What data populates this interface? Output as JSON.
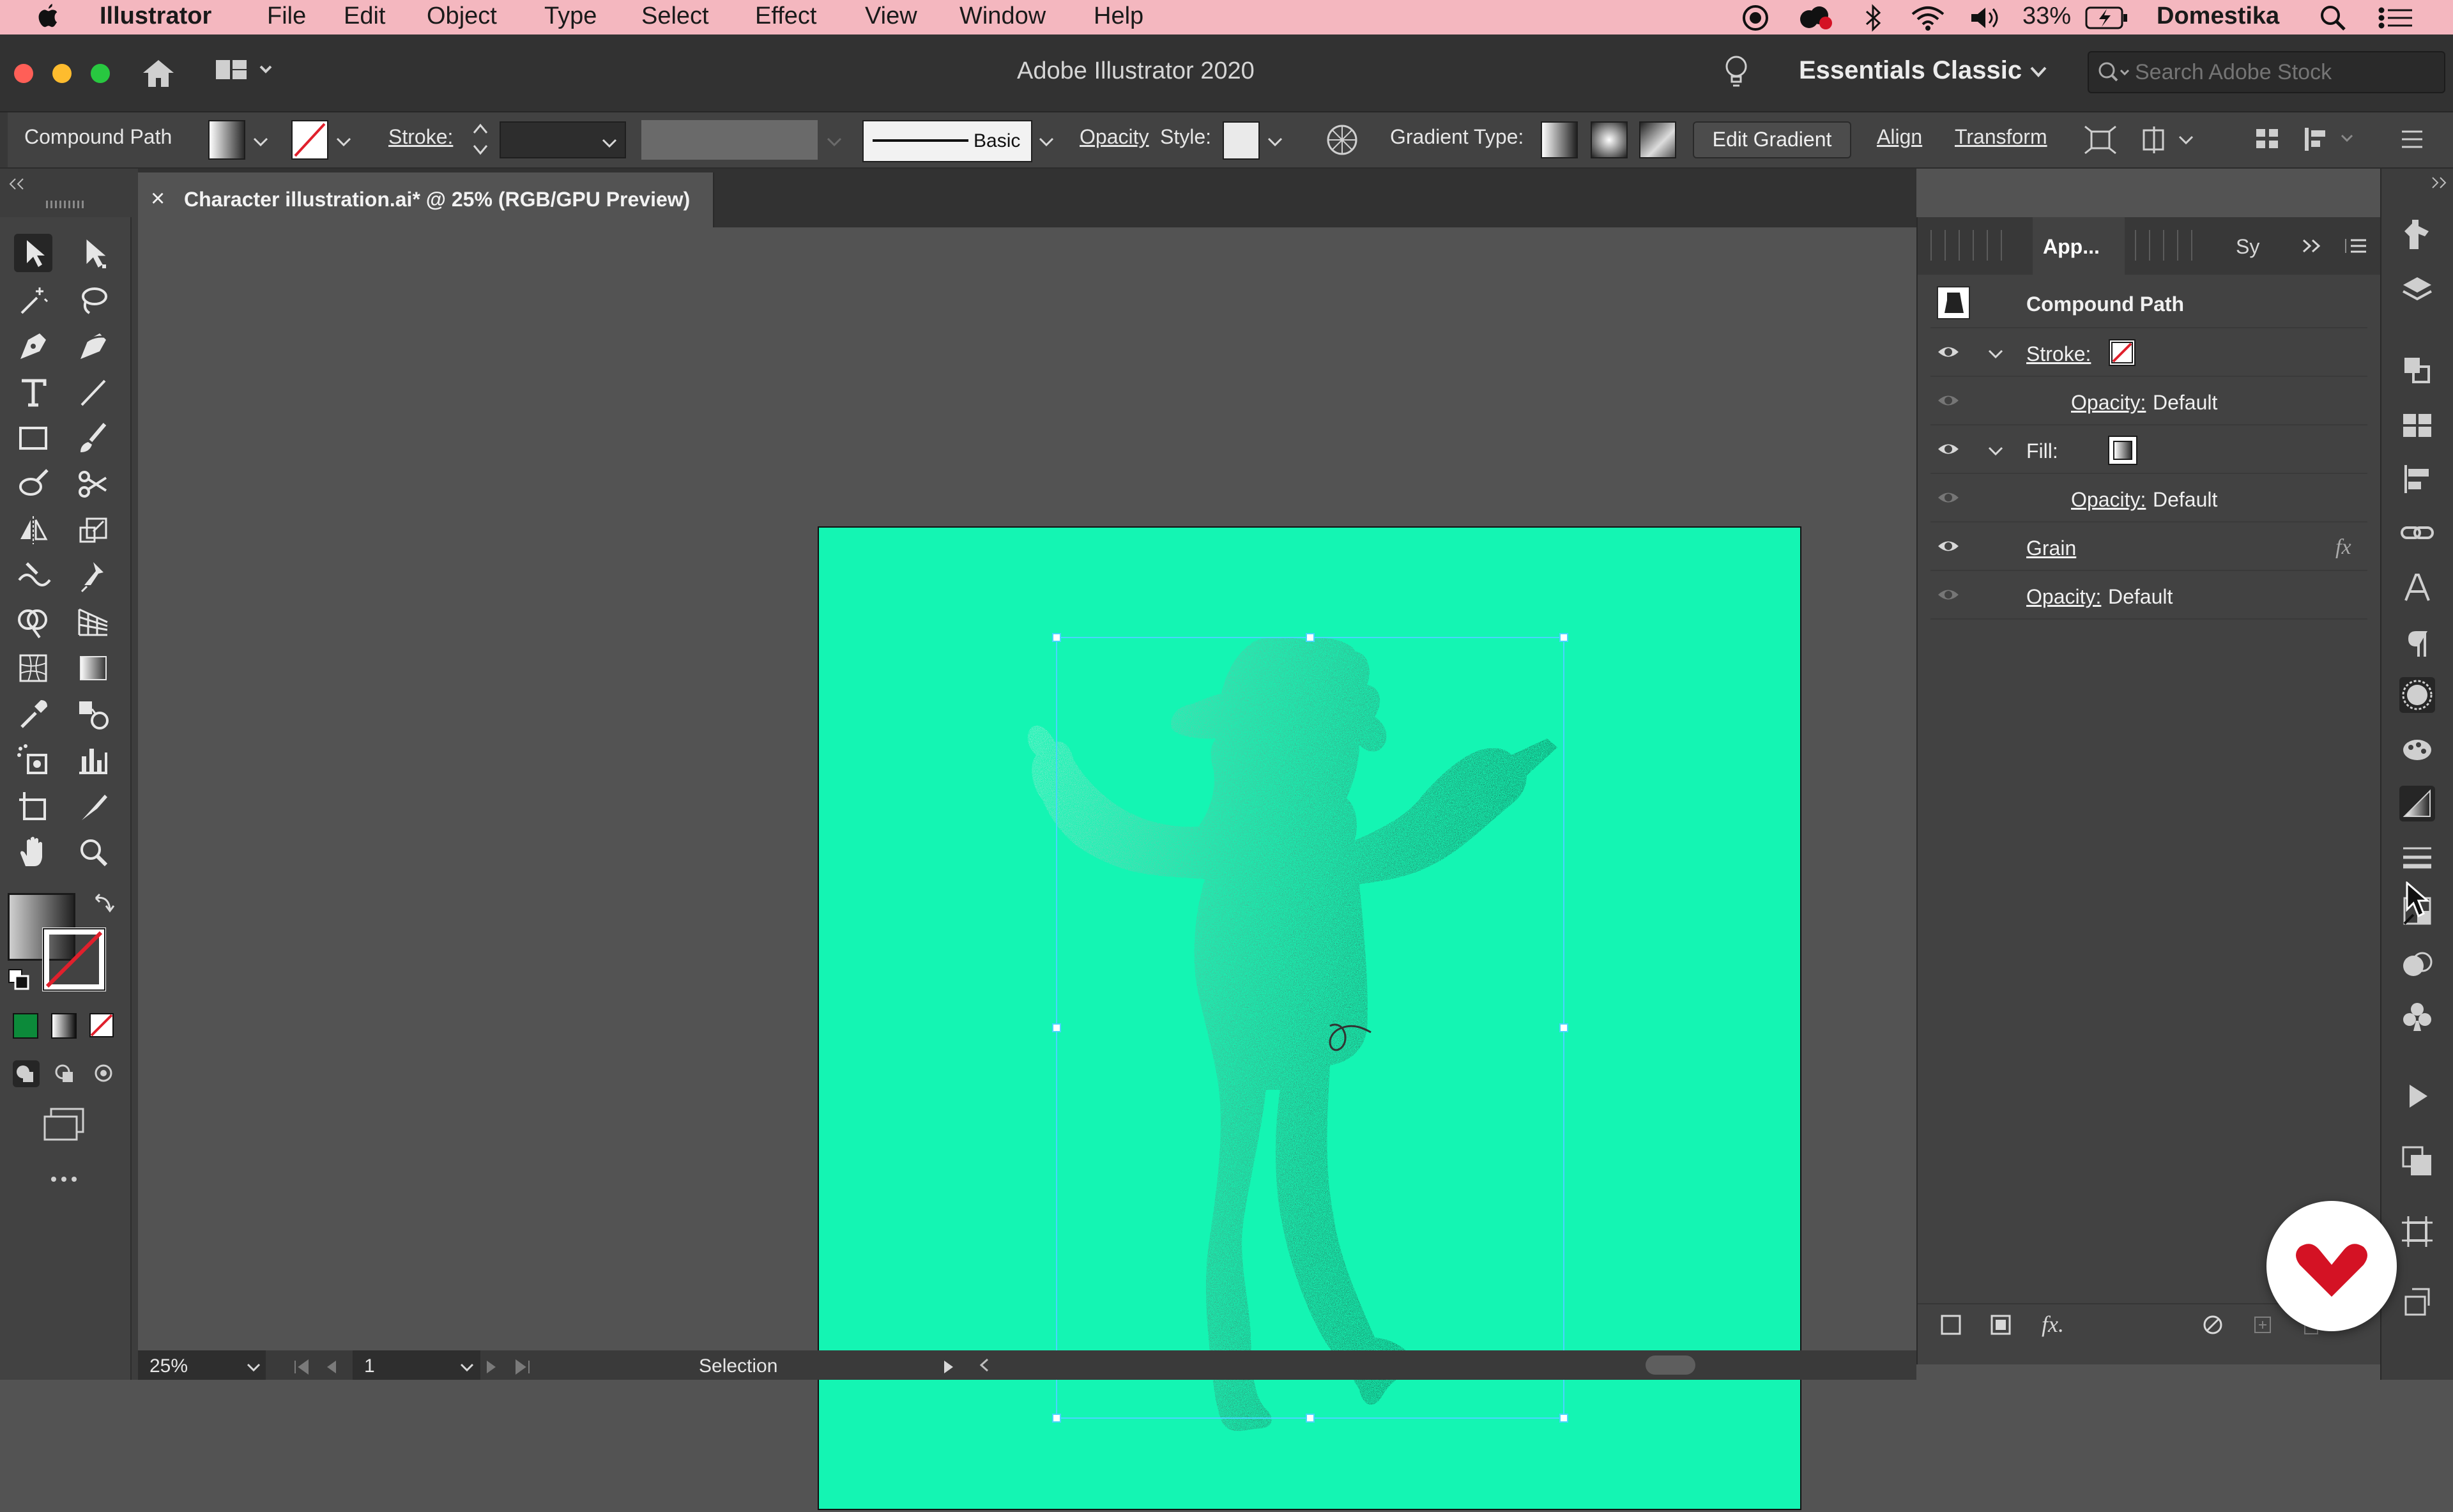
{
  "menubar": {
    "app_name": "Illustrator",
    "items": [
      "File",
      "Edit",
      "Object",
      "Type",
      "Select",
      "Effect",
      "View",
      "Window",
      "Help"
    ],
    "battery": "33%",
    "user": "Domestika"
  },
  "titlebar": {
    "title": "Adobe Illustrator 2020",
    "workspace": "Essentials Classic",
    "search_placeholder": "Search Adobe Stock"
  },
  "controlbar": {
    "object_type": "Compound Path",
    "stroke_label": "Stroke:",
    "brush_label": "Basic",
    "opacity_label": "Opacity",
    "style_label": "Style:",
    "gradient_type_label": "Gradient Type:",
    "edit_gradient": "Edit Gradient",
    "align": "Align",
    "transform": "Transform"
  },
  "document": {
    "tab_title": "Character illustration.ai* @ 25% (RGB/GPU Preview)",
    "close_glyph": "×",
    "artboard_color": "#14f5b3"
  },
  "statusbar": {
    "zoom": "25%",
    "artboard_number": "1",
    "tool": "Selection"
  },
  "panel": {
    "tab_active": "App...",
    "tab_other": "Sy",
    "title": "Compound Path",
    "rows": {
      "stroke_label": "Stroke:",
      "stroke_opacity_label": "Opacity:",
      "stroke_opacity_value": "Default",
      "fill_label": "Fill:",
      "fill_opacity_label": "Opacity:",
      "fill_opacity_value": "Default",
      "effect_label": "Grain",
      "fx_glyph": "fx",
      "opacity_label": "Opacity:",
      "opacity_value": "Default"
    }
  },
  "colors": {
    "menubar": "#f4b7bf",
    "ui_dark": "#424242",
    "selection": "#4ad5ff",
    "brand_red": "#d41224"
  }
}
